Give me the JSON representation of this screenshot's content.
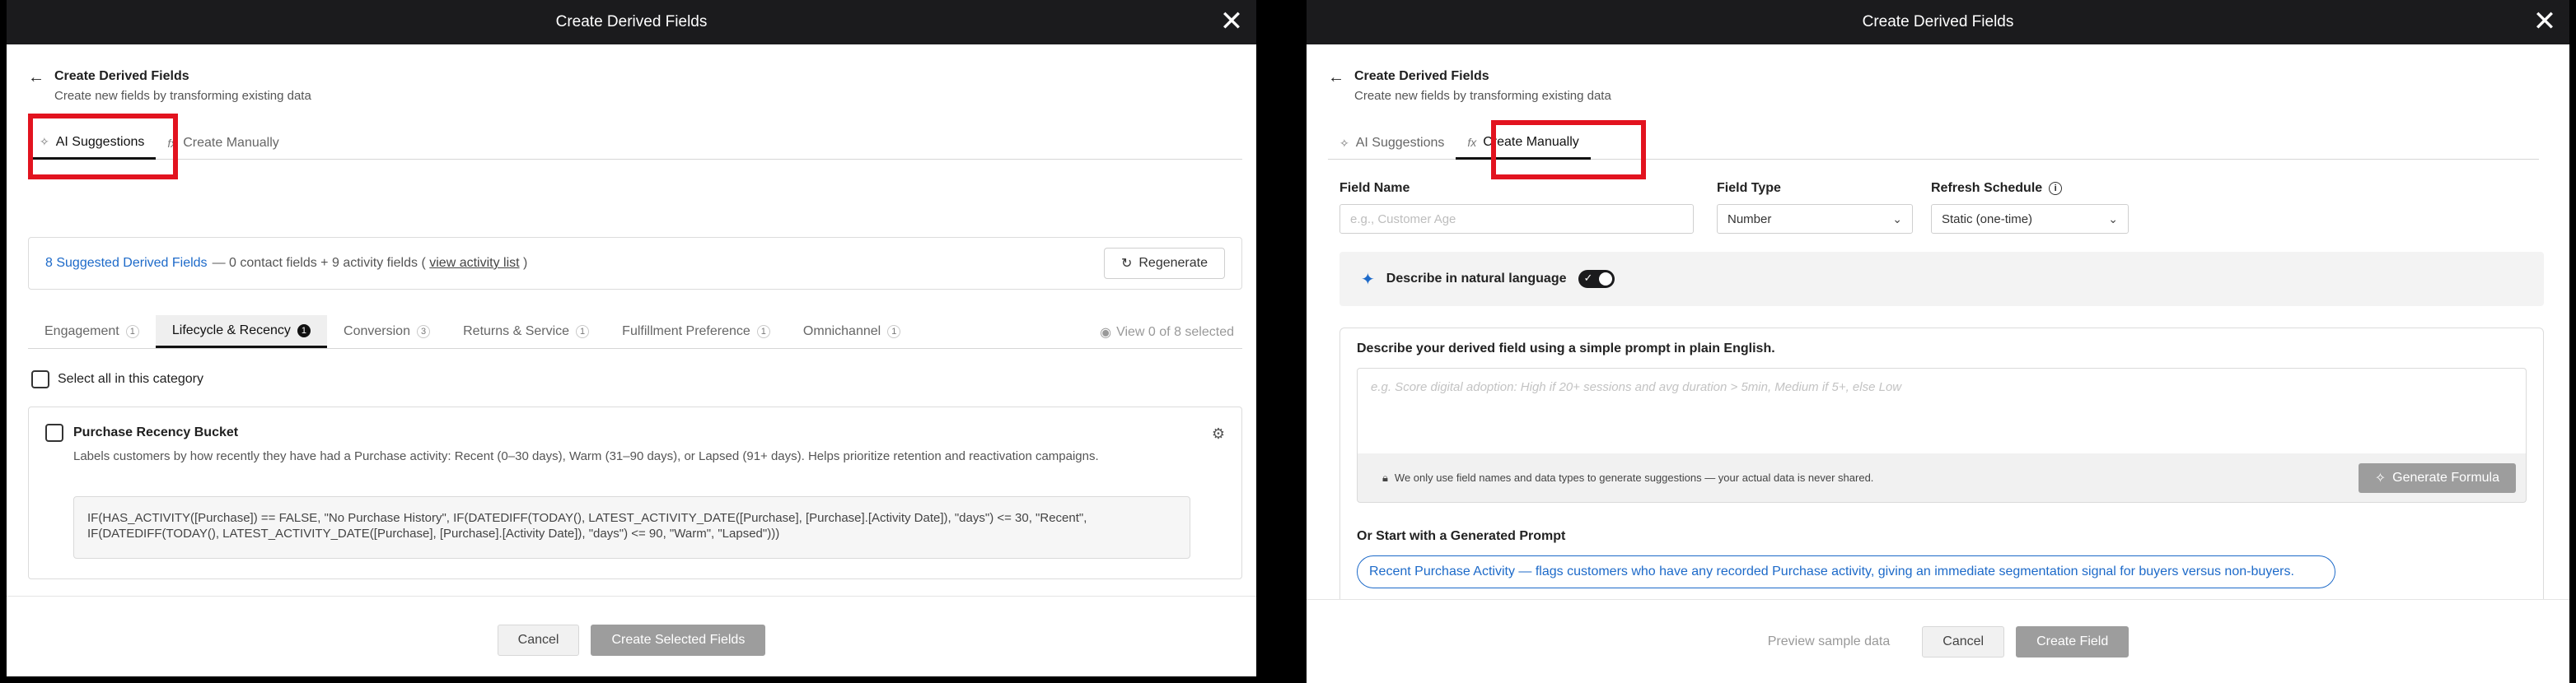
{
  "left": {
    "window_title": "Create Derived Fields",
    "header": {
      "title": "Create Derived Fields",
      "subtitle": "Create new fields by transforming existing data"
    },
    "tabs": [
      {
        "label": "AI Suggestions",
        "icon": "sparkle-icon",
        "active": true
      },
      {
        "label": "Create Manually",
        "icon": "fx-icon",
        "active": false
      }
    ],
    "summary": {
      "count_text": "8 Suggested Derived Fields",
      "detail_text": "— 0 contact fields + 9 activity fields (",
      "link_text": "view activity list",
      "close_paren": ")",
      "regenerate_label": "Regenerate"
    },
    "categories": [
      {
        "label": "Engagement",
        "count": "1",
        "active": false
      },
      {
        "label": "Lifecycle & Recency",
        "count": "1",
        "active": true
      },
      {
        "label": "Conversion",
        "count": "3",
        "active": false
      },
      {
        "label": "Returns & Service",
        "count": "1",
        "active": false
      },
      {
        "label": "Fulfillment Preference",
        "count": "1",
        "active": false
      },
      {
        "label": "Omnichannel",
        "count": "1",
        "active": false
      }
    ],
    "view_selected": "View 0 of 8 selected",
    "select_all_label": "Select all in this category",
    "card": {
      "title": "Purchase Recency Bucket",
      "description": "Labels customers by how recently they have had a Purchase activity: Recent (0–30 days), Warm (31–90 days), or Lapsed (91+ days). Helps prioritize retention and reactivation campaigns.",
      "formula": "IF(HAS_ACTIVITY([Purchase]) == FALSE, \"No Purchase History\", IF(DATEDIFF(TODAY(), LATEST_ACTIVITY_DATE([Purchase], [Purchase].[Activity Date]), \"days\") <= 30, \"Recent\", IF(DATEDIFF(TODAY(), LATEST_ACTIVITY_DATE([Purchase], [Purchase].[Activity Date]), \"days\") <= 90, \"Warm\", \"Lapsed\")))"
    },
    "footer": {
      "cancel_label": "Cancel",
      "create_label": "Create Selected Fields"
    }
  },
  "right": {
    "window_title": "Create Derived Fields",
    "header": {
      "title": "Create Derived Fields",
      "subtitle": "Create new fields by transforming existing data"
    },
    "tabs": [
      {
        "label": "AI Suggestions",
        "icon": "sparkle-icon",
        "active": false
      },
      {
        "label": "Create Manually",
        "icon": "fx-icon",
        "active": true
      }
    ],
    "fields": {
      "name_label": "Field Name",
      "name_placeholder": "e.g., Customer Age",
      "type_label": "Field Type",
      "type_value": "Number",
      "refresh_label": "Refresh Schedule",
      "refresh_value": "Static (one-time)"
    },
    "nl_label": "Describe in natural language",
    "describe": {
      "label": "Describe your derived field using a simple prompt in plain English.",
      "placeholder": "e.g. Score digital adoption: High if 20+ sessions and avg duration > 5min, Medium if 5+, else Low",
      "privacy_note": "We only use field names and data types to generate suggestions — your actual data is never shared.",
      "generate_label": "Generate Formula",
      "or_label": "Or Start with a Generated Prompt",
      "prompt_suggestion": "Recent Purchase Activity — flags customers who have any recorded Purchase activity, giving an immediate segmentation signal for buyers versus non-buyers."
    },
    "footer": {
      "preview_label": "Preview sample data",
      "cancel_label": "Cancel",
      "create_label": "Create Field"
    }
  }
}
